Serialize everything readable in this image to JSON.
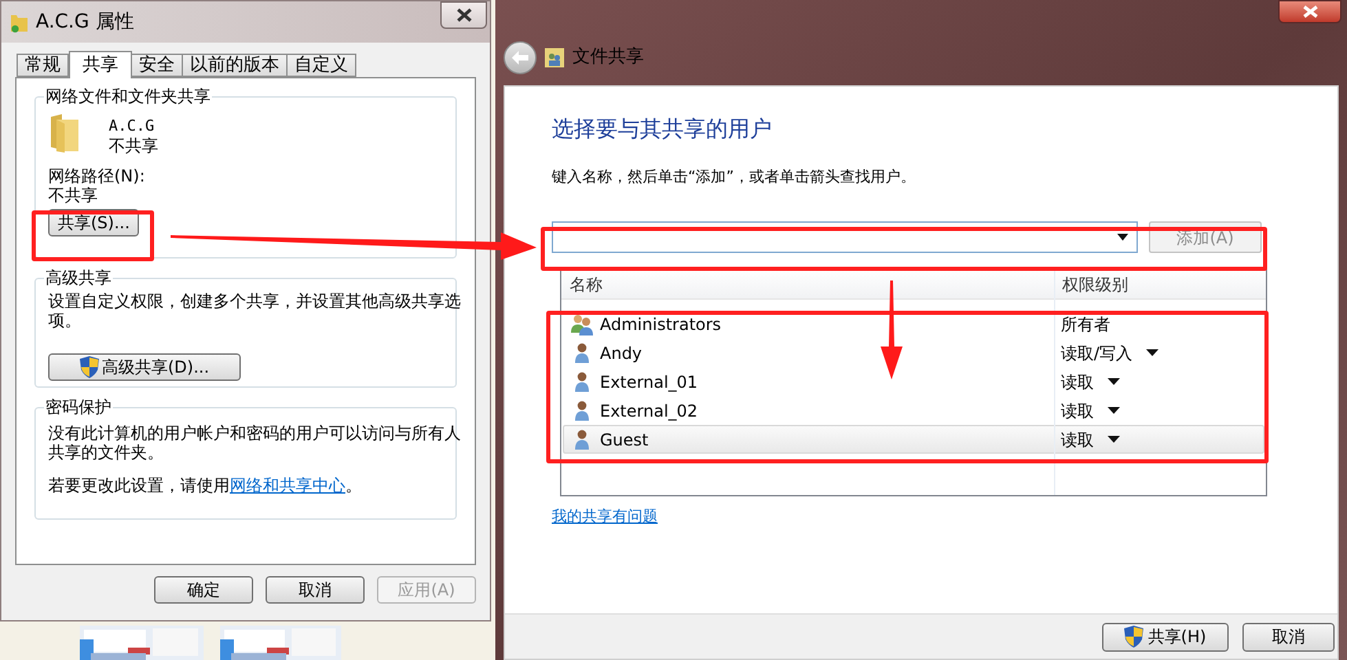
{
  "properties_window": {
    "title": "A.C.G 属性",
    "tabs": [
      {
        "label": "常规",
        "selected": false
      },
      {
        "label": "共享",
        "selected": true
      },
      {
        "label": "安全",
        "selected": false
      },
      {
        "label": "以前的版本",
        "selected": false
      },
      {
        "label": "自定义",
        "selected": false
      }
    ],
    "network_sharing": {
      "legend": "网络文件和文件夹共享",
      "item_name": "A.C.G",
      "item_status": "不共享",
      "path_label": "网络路径(N):",
      "path_value": "不共享",
      "share_button": "共享(S)..."
    },
    "advanced_sharing": {
      "legend": "高级共享",
      "description": "设置自定义权限，创建多个共享，并设置其他高级共享选项。",
      "button": "高级共享(D)..."
    },
    "password_protection": {
      "legend": "密码保护",
      "description": "没有此计算机的用户帐户和密码的用户可以访问与所有人共享的文件夹。",
      "note_prefix": "若要更改此设置，请使用",
      "link": "网络和共享中心",
      "note_suffix": "。"
    },
    "buttons": [
      {
        "label": "确定",
        "disabled": false
      },
      {
        "label": "取消",
        "disabled": false
      },
      {
        "label": "应用(A)",
        "disabled": true
      }
    ]
  },
  "file_sharing_window": {
    "title": "文件共享",
    "heading": "选择要与其共享的用户",
    "instruction": "键入名称，然后单击“添加”，或者单击箭头查找用户。",
    "add_button": {
      "label": "添加(A)",
      "disabled": true
    },
    "columns": [
      "名称",
      "权限级别"
    ],
    "users": [
      {
        "name": "Administrators",
        "kind": "group",
        "permission": "所有者",
        "has_dropdown": false,
        "selected": false
      },
      {
        "name": "Andy",
        "kind": "user",
        "permission": "读取/写入",
        "has_dropdown": true,
        "selected": false
      },
      {
        "name": "External_01",
        "kind": "user",
        "permission": "读取",
        "has_dropdown": true,
        "selected": false
      },
      {
        "name": "External_02",
        "kind": "user",
        "permission": "读取",
        "has_dropdown": true,
        "selected": false
      },
      {
        "name": "Guest",
        "kind": "user",
        "permission": "读取",
        "has_dropdown": true,
        "selected": true
      }
    ],
    "help_link": "我的共享有问题",
    "buttons": [
      {
        "label": "共享(H)",
        "shield": true
      },
      {
        "label": "取消",
        "shield": false
      }
    ]
  }
}
